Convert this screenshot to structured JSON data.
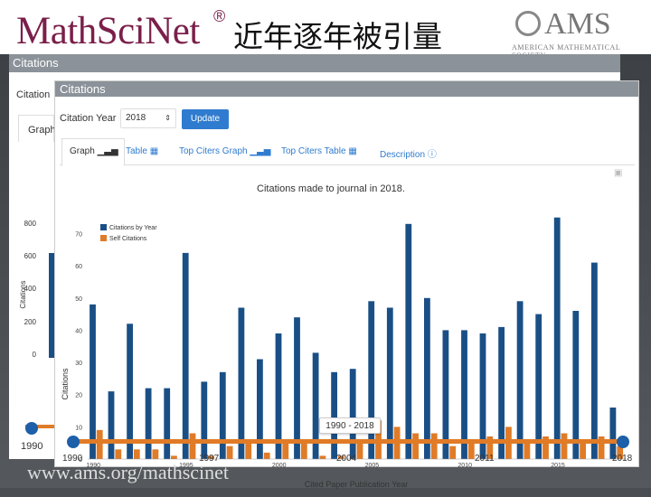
{
  "header": {
    "logo": "MathSciNet",
    "reg": "®",
    "title": "近年逐年被引量",
    "ams_logo": "AMS",
    "ams_sub": "AMERICAN MATHEMATICAL SOCIETY"
  },
  "back_window": {
    "bar_title": "Citations",
    "heading": "Citation",
    "tab": "Graph",
    "y_ticks": [
      "800",
      "600",
      "400",
      "200",
      "0"
    ],
    "y_label": "Citations",
    "slider_start": "1990"
  },
  "panel": {
    "bar_title": "Citations",
    "year_label": "Citation Year",
    "year_value": "2018",
    "update_label": "Update",
    "tabs": [
      {
        "label": "Graph"
      },
      {
        "label": "Table"
      },
      {
        "label": "Top Citers Graph"
      },
      {
        "label": "Top Citers Table"
      },
      {
        "label": "Description"
      }
    ]
  },
  "chart_data": {
    "type": "bar",
    "title": "Citations made to journal in 2018.",
    "xlabel": "Cited Paper Publication Year",
    "ylabel": "Citations",
    "ylim": [
      0,
      80
    ],
    "y_ticks": [
      0,
      10,
      20,
      30,
      40,
      50,
      60,
      70
    ],
    "x_tick_labels": [
      "1990",
      "1995",
      "2000",
      "2005",
      "2010",
      "2015"
    ],
    "x": [
      1990,
      1991,
      1992,
      1993,
      1994,
      1995,
      1996,
      1997,
      1998,
      1999,
      2000,
      2001,
      2002,
      2003,
      2004,
      2005,
      2006,
      2007,
      2008,
      2009,
      2010,
      2011,
      2012,
      2013,
      2014,
      2015,
      2016,
      2017,
      2018
    ],
    "series": [
      {
        "name": "Citations by Year",
        "color": "#1a4f86",
        "values": [
          48,
          21,
          42,
          22,
          22,
          64,
          24,
          27,
          47,
          31,
          39,
          44,
          33,
          27,
          28,
          49,
          47,
          73,
          50,
          40,
          40,
          39,
          41,
          49,
          45,
          75,
          46,
          61,
          16
        ]
      },
      {
        "name": "Self Citations",
        "color": "#e07b27",
        "values": [
          9,
          3,
          3,
          3,
          1,
          8,
          1,
          4,
          6,
          2,
          5,
          6,
          1,
          1,
          6,
          12,
          10,
          8,
          8,
          4,
          5,
          7,
          10,
          6,
          7,
          8,
          5,
          7,
          4
        ]
      }
    ],
    "legend": "top-left",
    "grid": false
  },
  "range_slider": {
    "range_label": "1990 - 2018",
    "tick_labels": [
      "1990",
      "1997",
      "2004",
      "2011",
      "2018"
    ]
  },
  "footer": {
    "url": "www.ams.org/mathscinet"
  }
}
